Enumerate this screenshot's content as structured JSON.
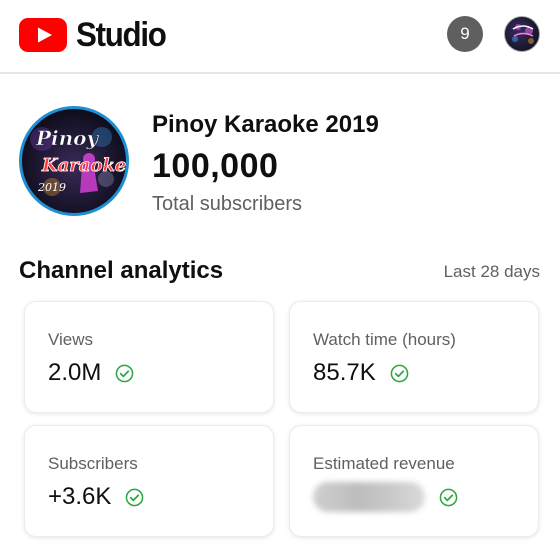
{
  "header": {
    "brand": "Studio",
    "notification_count": "9"
  },
  "channel": {
    "name": "Pinoy Karaoke 2019",
    "subscriber_count": "100,000",
    "subscriber_label": "Total subscribers",
    "avatar_text": {
      "line1": "Pinoy",
      "line2": "Karaoke",
      "line3": "2019"
    }
  },
  "analytics": {
    "title": "Channel analytics",
    "period": "Last 28 days",
    "cards": [
      {
        "label": "Views",
        "value": "2.0M",
        "status_icon": "check-circle-icon"
      },
      {
        "label": "Watch time (hours)",
        "value": "85.7K",
        "status_icon": "check-circle-icon"
      },
      {
        "label": "Subscribers",
        "value": "+3.6K",
        "status_icon": "check-circle-icon"
      },
      {
        "label": "Estimated revenue",
        "value": "",
        "status_icon": "check-circle-icon"
      }
    ]
  },
  "colors": {
    "youtube_red": "#ff0000",
    "check_green": "#2ba640",
    "avatar_ring": "#1f8fd2"
  }
}
